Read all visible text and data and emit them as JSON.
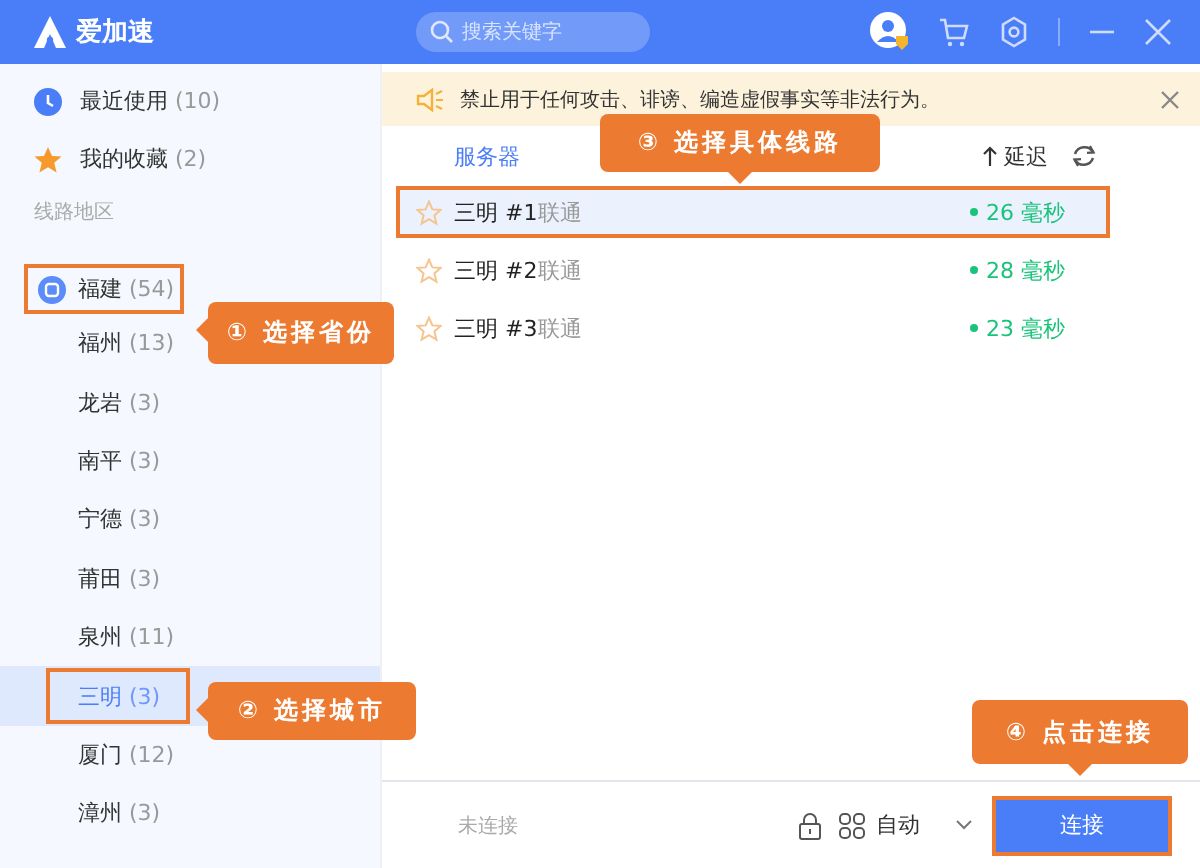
{
  "app": {
    "title": "爱加速"
  },
  "search": {
    "placeholder": "搜索关键字"
  },
  "notice": {
    "text": "禁止用于任何攻击、诽谤、编造虚假事实等非法行为。"
  },
  "sidebar": {
    "items": [
      {
        "kind": "recent",
        "label": "最近使用",
        "count": "(10)"
      },
      {
        "kind": "favorites",
        "label": "我的收藏",
        "count": "(2)"
      }
    ],
    "section_title": "线路地区",
    "regions": [
      {
        "label": "福建",
        "count": "(54)",
        "highlighted": true,
        "children": [
          {
            "label": "福州",
            "count": "(13)",
            "selected": false,
            "highlighted": false
          },
          {
            "label": "龙岩",
            "count": "(3)",
            "selected": false,
            "highlighted": false
          },
          {
            "label": "南平",
            "count": "(3)",
            "selected": false,
            "highlighted": false
          },
          {
            "label": "宁德",
            "count": "(3)",
            "selected": false,
            "highlighted": false
          },
          {
            "label": "莆田",
            "count": "(3)",
            "selected": false,
            "highlighted": false
          },
          {
            "label": "泉州",
            "count": "(11)",
            "selected": false,
            "highlighted": false
          },
          {
            "label": "三明",
            "count": "(3)",
            "selected": true,
            "highlighted": true
          },
          {
            "label": "厦门",
            "count": "(12)",
            "selected": false,
            "highlighted": false
          },
          {
            "label": "漳州",
            "count": "(3)",
            "selected": false,
            "highlighted": false
          }
        ]
      }
    ]
  },
  "table": {
    "columns": [
      {
        "label": "服务器",
        "sorted": false
      },
      {
        "label": "延迟",
        "sorted": true
      }
    ],
    "rows": [
      {
        "name": "三明 #1",
        "isp": "联通",
        "latency": "26 毫秒",
        "favorite": false,
        "selected": true,
        "highlighted": true
      },
      {
        "name": "三明 #2",
        "isp": "联通",
        "latency": "28 毫秒",
        "favorite": false,
        "selected": false,
        "highlighted": false
      },
      {
        "name": "三明 #3",
        "isp": "联通",
        "latency": "23 毫秒",
        "favorite": false,
        "selected": false,
        "highlighted": false
      }
    ]
  },
  "footer": {
    "status": "未连接",
    "mode": "自动",
    "connect_button": {
      "label": "连接",
      "highlighted": true
    }
  },
  "callouts": [
    {
      "text": "① 选择省份"
    },
    {
      "text": "② 选择城市"
    },
    {
      "text": "③ 选择具体线路"
    },
    {
      "text": "④ 点击连接"
    }
  ]
}
